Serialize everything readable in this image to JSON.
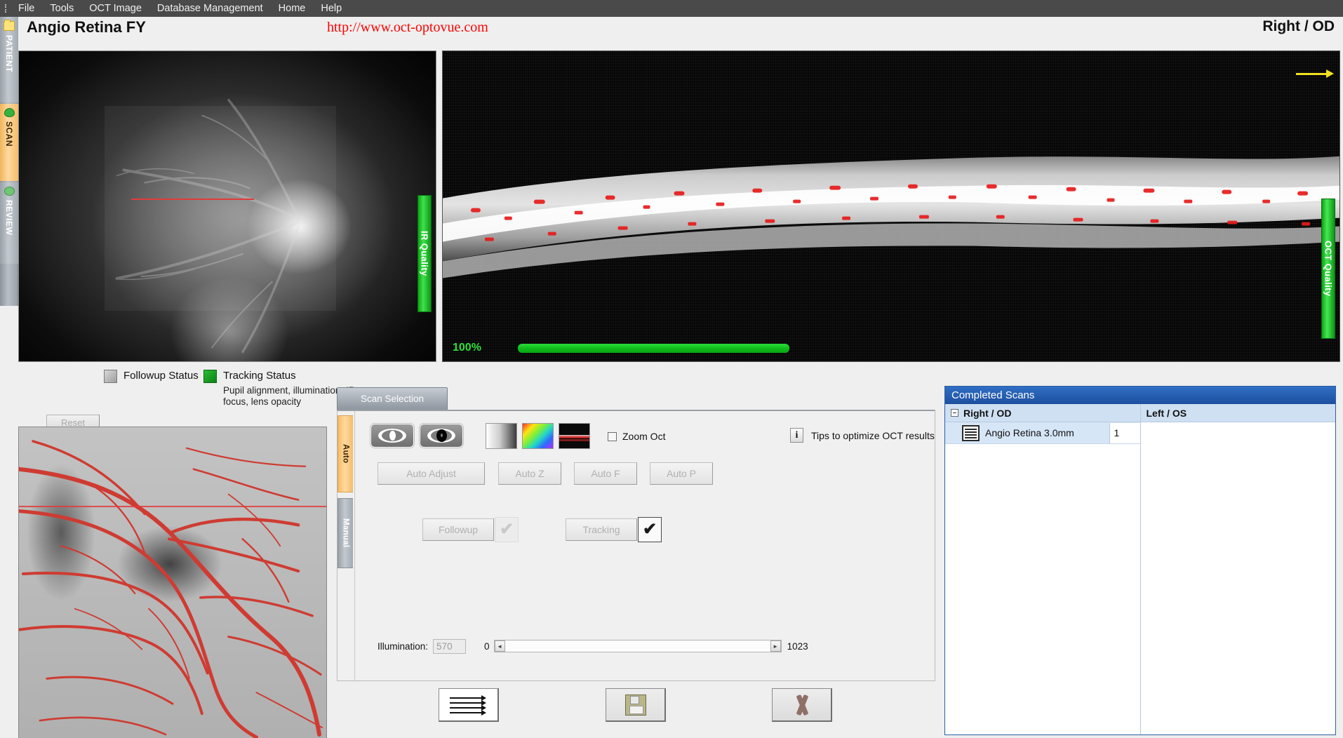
{
  "menubar": {
    "items": [
      "File",
      "Tools",
      "OCT Image",
      "Database Management",
      "Home",
      "Help"
    ]
  },
  "rail": {
    "items": [
      {
        "label": "PATIENT",
        "icon": "folder-icon",
        "active": false
      },
      {
        "label": "SCAN",
        "icon": "eye-icon",
        "active": true
      },
      {
        "label": "REVIEW",
        "icon": "eye-review-icon",
        "active": false
      }
    ]
  },
  "header": {
    "title": "Angio Retina FY",
    "url": "http://www.oct-optovue.com",
    "eye_label": "Right / OD"
  },
  "ir_image": {
    "quality_bar_label": "IR Quality"
  },
  "oct_image": {
    "quality_bar_label": "OCT Quality",
    "percent": "100%"
  },
  "status": {
    "followup_label": "Followup Status",
    "followup_color": "#b4b4b4",
    "tracking_label": "Tracking Status",
    "tracking_color": "#1d9c26",
    "tracking_detail": "Pupil alignment, illumination, IR focus, lens opacity",
    "reset_label": "Reset"
  },
  "panel": {
    "tab_label": "Scan Selection",
    "vtabs": [
      {
        "label": "Auto",
        "active": true
      },
      {
        "label": "Manual",
        "active": false
      }
    ],
    "zoom_oct_label": "Zoom Oct",
    "zoom_oct_checked": false,
    "tips_label": "Tips to optimize OCT results",
    "tips_icon_label": "i",
    "auto_buttons": [
      {
        "label": "Auto Adjust"
      },
      {
        "label": "Auto Z"
      },
      {
        "label": "Auto F"
      },
      {
        "label": "Auto P"
      }
    ],
    "followup_button": "Followup",
    "followup_checked": false,
    "tracking_button": "Tracking",
    "tracking_checked": true,
    "check_glyph": "✔",
    "illumination": {
      "label": "Illumination:",
      "value": "570",
      "min": "0",
      "max": "1023",
      "left_arrow": "◄",
      "right_arrow": "►"
    }
  },
  "actions": {
    "scan_lines_button": "scan-lines-button",
    "save_button": "save-button",
    "cancel_button": "cancel-button"
  },
  "completed_scans": {
    "title": "Completed Scans",
    "columns": [
      {
        "header": "Right / OD",
        "expandable": true,
        "rows": [
          {
            "name": "Angio Retina  3.0mm",
            "count": "1"
          }
        ]
      },
      {
        "header": "Left / OS",
        "expandable": false,
        "rows": []
      }
    ]
  }
}
